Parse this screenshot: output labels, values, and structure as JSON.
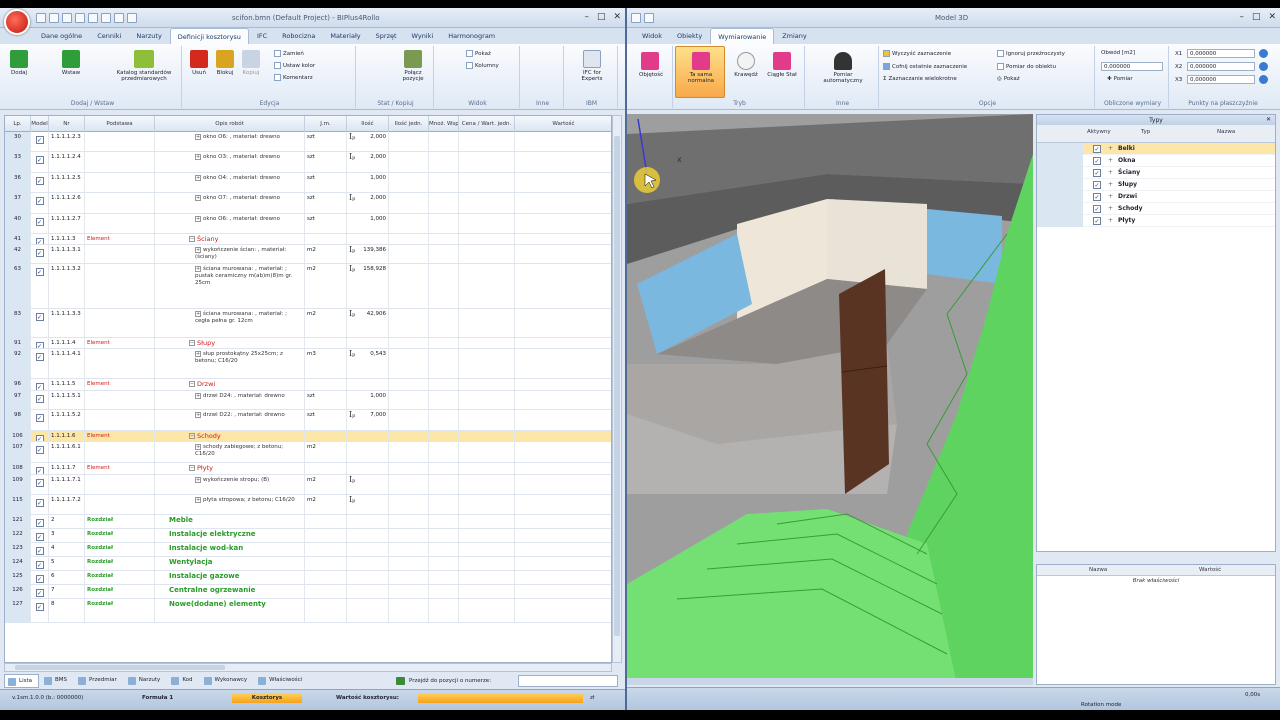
{
  "left": {
    "title": "scifon.bmn (Default Project) - BIPlus4Rollo",
    "tabs": [
      "Dane ogólne",
      "Cenniki",
      "Narzuty",
      "Definicji kosztorysu",
      "IFC",
      "Robocizna",
      "Materiały",
      "Sprzęt",
      "Wyniki",
      "Harmonogram"
    ],
    "active_tab": 3,
    "ribbon": {
      "groups": [
        "Dodaj / Wstaw",
        "Edycja",
        "Stat / Kopiuj",
        "Widok",
        "Inne",
        "IBM"
      ],
      "btn_dodaj": "Dodaj",
      "btn_wstaw": "Wstaw",
      "btn_katalog": "Katalog standardów przedmiarowych",
      "btn_usun": "Usuń",
      "btn_blokuj": "Blokuj",
      "btn_kopiuj": "Kopiuj",
      "btn_zamien": "Zamień",
      "btn_ustaw_kolor": "Ustaw kolor",
      "btn_komentarz": "Komentarz",
      "btn_polacz": "Połącz pozycje",
      "btn_pokaz": "Pokaż",
      "btn_kolumny": "Kolumny",
      "btn_ifc": "IFC for Experts"
    },
    "columns": [
      "Lp.",
      "Model",
      "Nr",
      "Podstawa",
      "Opis robót",
      "J.m.",
      "Ilość",
      "Ilość jedn.",
      "Mnoż. Współ.",
      "Cena / Wart. jedn.",
      "Wartość"
    ],
    "rows": [
      {
        "lp": "30",
        "nr": "1.1.1.1.2.3",
        "pod": "",
        "desc": "okno O6: , materiał: drewno",
        "jm": "szt",
        "ip": true,
        "qty": "2,000",
        "kind": "it",
        "h": 20
      },
      {
        "lp": "33",
        "nr": "1.1.1.1.2.4",
        "pod": "",
        "desc": "okno O3: , materiał: drewno",
        "jm": "szt",
        "ip": true,
        "qty": "2,000",
        "kind": "it",
        "h": 21
      },
      {
        "lp": "36",
        "nr": "1.1.1.1.2.5",
        "pod": "",
        "desc": "okno O4: , materiał: drewno",
        "jm": "szt",
        "ip": false,
        "qty": "1,000",
        "kind": "it",
        "h": 20
      },
      {
        "lp": "37",
        "nr": "1.1.1.1.2.6",
        "pod": "",
        "desc": "okno O7: , materiał: drewno",
        "jm": "szt",
        "ip": true,
        "qty": "2,000",
        "kind": "it",
        "h": 21
      },
      {
        "lp": "40",
        "nr": "1.1.1.1.2.7",
        "pod": "",
        "desc": "okno O6: , materiał: drewno",
        "jm": "szt",
        "ip": false,
        "qty": "1,000",
        "kind": "it",
        "h": 20
      },
      {
        "lp": "41",
        "nr": "1.1.1.1.3",
        "pod": "Element",
        "desc": "Ściany",
        "jm": "",
        "ip": false,
        "qty": "",
        "kind": "el",
        "h": 11
      },
      {
        "lp": "42",
        "nr": "1.1.1.1.3.1",
        "pod": "",
        "desc": "wykończenie ścian: , materiał: (ściany)",
        "jm": "m2",
        "ip": true,
        "qty": "139,386",
        "kind": "it",
        "h": 19
      },
      {
        "lp": "63",
        "nr": "1.1.1.1.3.2",
        "pod": "",
        "desc": "ściana murowana: , materiał: ; pustak ceramiczny m(ab)m(8)m gr. 25cm",
        "jm": "m2",
        "ip": true,
        "qty": "158,928",
        "kind": "it",
        "h": 45
      },
      {
        "lp": "83",
        "nr": "1.1.1.1.3.3",
        "pod": "",
        "desc": "ściana murowana: , materiał: ; cegła pełna gr. 12cm",
        "jm": "m2",
        "ip": true,
        "qty": "42,906",
        "kind": "it",
        "h": 29
      },
      {
        "lp": "91",
        "nr": "1.1.1.1.4",
        "pod": "Element",
        "desc": "Słupy",
        "jm": "",
        "ip": false,
        "qty": "",
        "kind": "el",
        "h": 11
      },
      {
        "lp": "92",
        "nr": "1.1.1.1.4.1",
        "pod": "",
        "desc": "słup prostokątny 25x25cm; z betonu; C16/20",
        "jm": "m3",
        "ip": true,
        "qty": "0,543",
        "kind": "it",
        "h": 30
      },
      {
        "lp": "96",
        "nr": "1.1.1.1.5",
        "pod": "Element",
        "desc": "Drzwi",
        "jm": "",
        "ip": false,
        "qty": "",
        "kind": "el",
        "h": 12
      },
      {
        "lp": "97",
        "nr": "1.1.1.1.5.1",
        "pod": "",
        "desc": "drzwi D24: , materiał: drewno",
        "jm": "szt",
        "ip": false,
        "qty": "1,000",
        "kind": "it",
        "h": 19
      },
      {
        "lp": "98",
        "nr": "1.1.1.1.5.2",
        "pod": "",
        "desc": "drzwi D22: , materiał: drewno",
        "jm": "szt",
        "ip": true,
        "qty": "7,000",
        "kind": "it",
        "h": 21
      },
      {
        "lp": "106",
        "nr": "1.1.1.1.6",
        "pod": "Element",
        "desc": "Schody",
        "jm": "",
        "ip": false,
        "qty": "",
        "kind": "el",
        "h": 11,
        "sel": true
      },
      {
        "lp": "107",
        "nr": "1.1.1.1.6.1",
        "pod": "",
        "desc": "schody zabiegowe; z betonu; C16/20",
        "jm": "m2",
        "ip": false,
        "qty": "",
        "kind": "it",
        "h": 21
      },
      {
        "lp": "108",
        "nr": "1.1.1.1.7",
        "pod": "Element",
        "desc": "Płyty",
        "jm": "",
        "ip": false,
        "qty": "",
        "kind": "el",
        "h": 12
      },
      {
        "lp": "109",
        "nr": "1.1.1.1.7.1",
        "pod": "",
        "desc": "wykończenie stropu; (B)",
        "jm": "m2",
        "ip": true,
        "qty": "",
        "kind": "it",
        "h": 20
      },
      {
        "lp": "115",
        "nr": "1.1.1.1.7.2",
        "pod": "",
        "desc": "płyta stropowa; z betonu; C16/20",
        "jm": "m2",
        "ip": true,
        "qty": "",
        "kind": "it",
        "h": 20
      },
      {
        "lp": "121",
        "nr": "2",
        "pod": "Rozdział",
        "desc": "Meble",
        "jm": "",
        "ip": false,
        "qty": "",
        "kind": "ch",
        "h": 14
      },
      {
        "lp": "122",
        "nr": "3",
        "pod": "Rozdział",
        "desc": "Instalacje elektryczne",
        "jm": "",
        "ip": false,
        "qty": "",
        "kind": "ch",
        "h": 14
      },
      {
        "lp": "123",
        "nr": "4",
        "pod": "Rozdział",
        "desc": "Instalacje wod-kan",
        "jm": "",
        "ip": false,
        "qty": "",
        "kind": "ch",
        "h": 14
      },
      {
        "lp": "124",
        "nr": "5",
        "pod": "Rozdział",
        "desc": "Wentylacja",
        "jm": "",
        "ip": false,
        "qty": "",
        "kind": "ch",
        "h": 14
      },
      {
        "lp": "125",
        "nr": "6",
        "pod": "Rozdział",
        "desc": "Instalacje gazowe",
        "jm": "",
        "ip": false,
        "qty": "",
        "kind": "ch",
        "h": 14
      },
      {
        "lp": "126",
        "nr": "7",
        "pod": "Rozdział",
        "desc": "Centralne ogrzewanie",
        "jm": "",
        "ip": false,
        "qty": "",
        "kind": "ch",
        "h": 14
      },
      {
        "lp": "127",
        "nr": "8",
        "pod": "Rozdział",
        "desc": "Nowe(dodane) elementy",
        "jm": "",
        "ip": false,
        "qty": "",
        "kind": "ch",
        "h": 24
      }
    ],
    "bottom_tabs": [
      "Lista",
      "BMS",
      "Przedmiar",
      "Narzuty",
      "Kod",
      "Wykonawcy",
      "Właściwości"
    ],
    "goto_label": "Przejdź do pozycji o numerze:",
    "status": [
      "v.1sm.1.0.0 (b.: 0000000)",
      "Formuła 1",
      "Kosztorys",
      "Wartość kosztorysu:",
      "zł"
    ]
  },
  "right": {
    "title": "Model 3D",
    "tabs": [
      "Widok",
      "Obiekty",
      "Wymiarowanie",
      "Zmiany"
    ],
    "active_tab": 2,
    "ribbon": {
      "groups": [
        "Tryb",
        "Inne",
        "Opcje",
        "Obliczone wymiary",
        "Punkty na płaszczyźnie"
      ],
      "btn_objetosc": "Objętość",
      "btn_ta_sama": "Ta sama normalna",
      "btn_krawedz": "Krawędź",
      "btn_ciagle": "Ciągłe Stał",
      "btn_pomiar": "Pomiar automatyczny",
      "opt_wyczysc": "Wyczyść zaznaczenie",
      "opt_cofnij": "Cofnij ostatnie zaznaczenie",
      "opt_zaznaczanie": "Zaznaczanie wielokrotne",
      "opt_ignoruj": "Ignoruj przeźroczysty",
      "opt_pomiar_obiektu": "Pomiar do obiektu",
      "opt_pokaz": "Pokaż",
      "obwod_label": "Obwód [m2]",
      "obwod_value": "0,000000",
      "pomiar_label": "Pomiar",
      "x1": "X1",
      "x2": "X2",
      "x3": "X3",
      "x1v": "0,000000",
      "x2v": "0,000000",
      "x3v": "0,000000"
    },
    "tree": {
      "title": "Typy",
      "col_aktywny": "Aktywny",
      "col_typ": "Typ",
      "col_nazwa": "Nazwa",
      "items": [
        "Belki",
        "Okna",
        "Ściany",
        "Słupy",
        "Drzwi",
        "Schody",
        "Płyty"
      ],
      "selected": 0
    },
    "props": {
      "col_nazwa": "Nazwa",
      "col_wartosc": "Wartość",
      "empty": "Brak właściwości"
    },
    "viewport_marker": "x",
    "status_right": "0,00s",
    "status_bottom": "Rotation mode"
  },
  "colors": {
    "accent": "#2a9a2a",
    "element": "#d01818",
    "selection": "#fde7a8",
    "green_stairs": "#6ee06e"
  }
}
